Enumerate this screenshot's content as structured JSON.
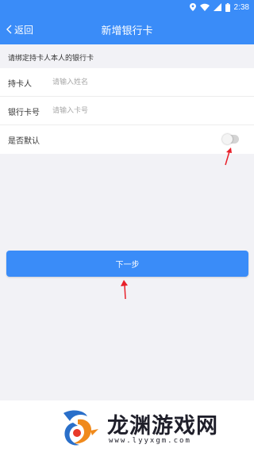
{
  "status_bar": {
    "time": "2:38",
    "icons": [
      "location-icon",
      "wifi-icon",
      "signal-icon",
      "battery-icon"
    ]
  },
  "nav": {
    "back_label": "返回",
    "title": "新增银行卡"
  },
  "hint": "请绑定持卡人本人的银行卡",
  "form": {
    "cardholder": {
      "label": "持卡人",
      "placeholder": "请输入姓名"
    },
    "card_number": {
      "label": "银行卡号",
      "placeholder": "请输入卡号"
    },
    "default": {
      "label": "是否默认",
      "value": false
    }
  },
  "next_button": "下一步",
  "watermark": {
    "title": "龙渊游戏网",
    "url": "www.lyyxgm.com"
  },
  "colors": {
    "primary": "#3a8cf8",
    "background": "#f2f2f6",
    "annotation": "#e8202a"
  }
}
